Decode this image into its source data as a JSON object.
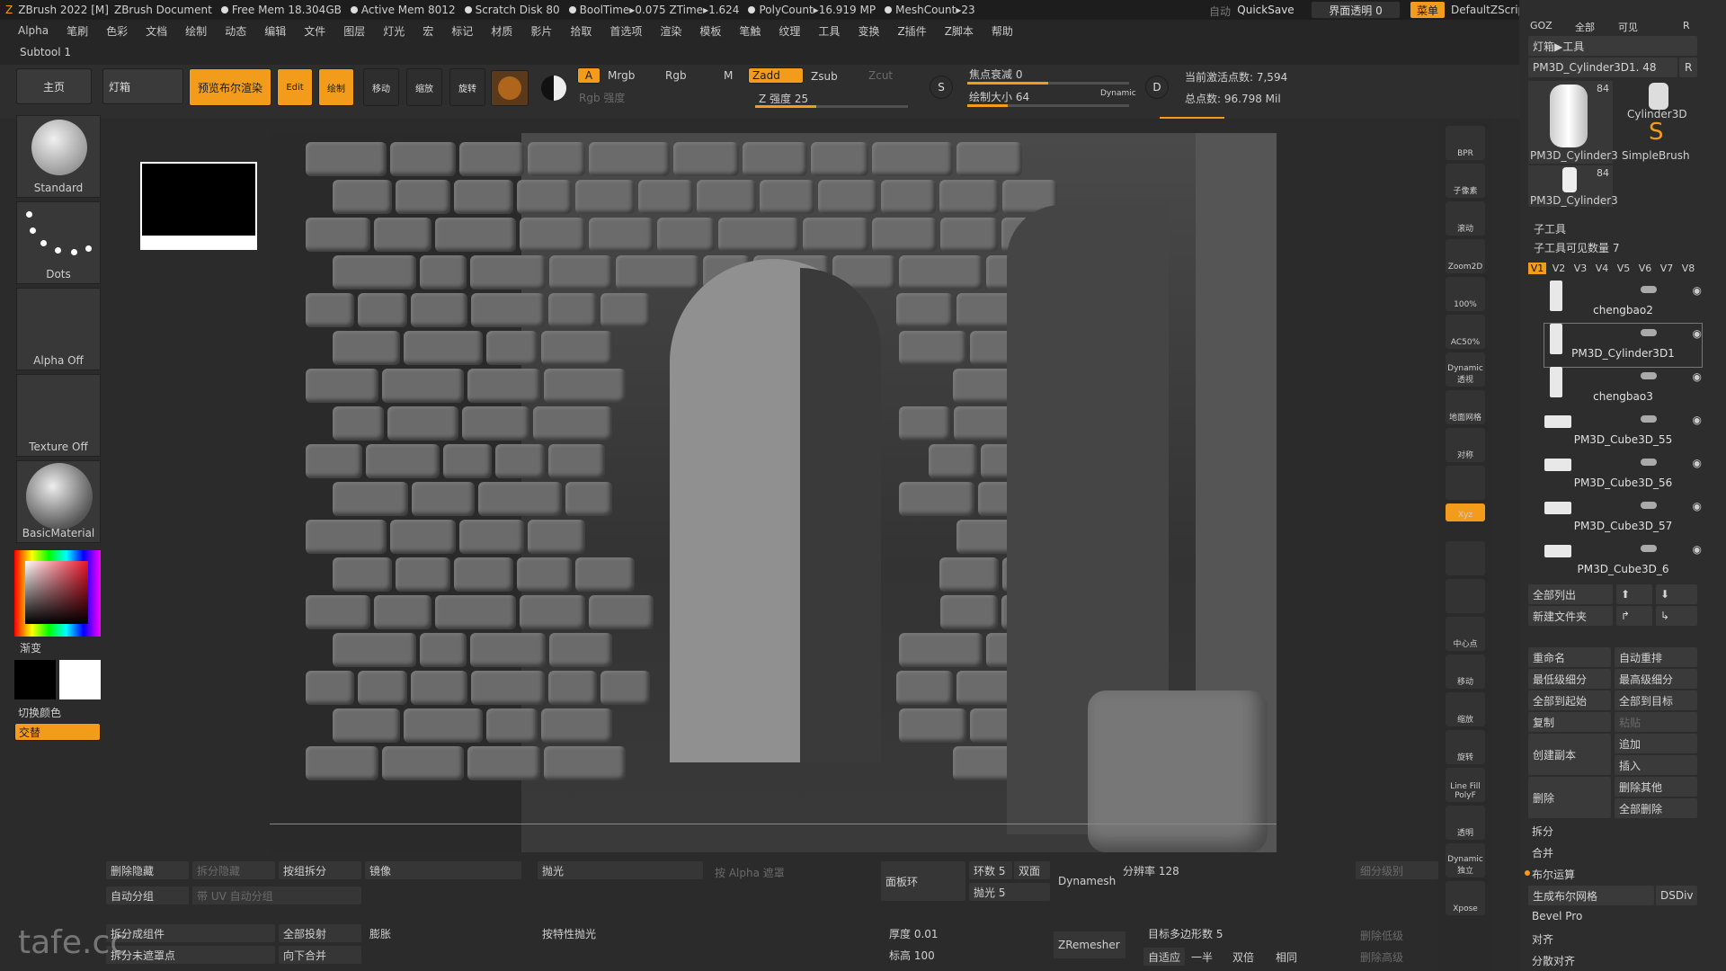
{
  "titlebar": {
    "app": "ZBrush 2022 [M]",
    "doc": "ZBrush Document",
    "free_mem": "Free Mem 18.304GB",
    "active_mem": "Active Mem 8012",
    "scratch": "Scratch Disk 80",
    "booltime": "BoolTime▸0.075 ZTime▸1.624",
    "polycount": "PolyCount▸16.919 MP",
    "meshcount": "MeshCount▸23",
    "auto": "自动",
    "quicksave": "QuickSave",
    "transparency": "界面透明 0",
    "menu": "菜单",
    "script": "DefaultZScript"
  },
  "menubar": [
    "Alpha",
    "笔刷",
    "色彩",
    "文档",
    "绘制",
    "动态",
    "编辑",
    "文件",
    "图层",
    "灯光",
    "宏",
    "标记",
    "材质",
    "影片",
    "拾取",
    "首选项",
    "渲染",
    "模板",
    "笔触",
    "纹理",
    "工具",
    "变换",
    "Z插件",
    "Z脚本",
    "帮助"
  ],
  "subtool_label": "Subtool 1",
  "toolrow": {
    "home": "主页",
    "lightbox": "灯箱",
    "bpr": "预览布尔渲染",
    "edit": "Edit",
    "draw": "绘制",
    "move": "移动",
    "scale": "缩放",
    "rotate": "旋转",
    "a": "A",
    "mrgb": "Mrgb",
    "rgb": "Rgb",
    "m": "M",
    "rgb_intensity": "Rgb 强度",
    "zadd": "Zadd",
    "zsub": "Zsub",
    "zcut": "Zcut",
    "z_intensity": "Z 强度 25",
    "focal": "焦点衰减 0",
    "draw_size": "绘制大小 64",
    "dynamic": "Dynamic",
    "active_points": "当前激活点数: 7,594",
    "total_points": "总点数: 96.798 Mil"
  },
  "leftpanel": {
    "brush": "Standard",
    "stroke": "Dots",
    "alpha": "Alpha Off",
    "texture": "Texture Off",
    "material": "BasicMaterial",
    "gradient": "渐变",
    "switch_color": "切换颜色",
    "alternate": "交替"
  },
  "shelf": [
    "BPR",
    "子像素",
    "滚动",
    "Zoom2D",
    "100%",
    "AC50%",
    "Dynamic 透视",
    "地面网格",
    "对称",
    "",
    "Xyz",
    "",
    "",
    "中心点",
    "移动",
    "缩放",
    "旋转",
    "Line Fill PolyF",
    "透明",
    "Dynamic 独立",
    "Xpose"
  ],
  "rightpanel": {
    "goz": "GOZ",
    "all": "全部",
    "visible": "可见",
    "r": "R",
    "lightbox_tool": "灯箱▶工具",
    "current_tool": "PM3D_Cylinder3D1. 48",
    "r2": "R",
    "thumbs": [
      {
        "name": "PM3D_Cylinder3",
        "count": "84"
      },
      {
        "name": "Cylinder3D",
        "count": ""
      },
      {
        "name": "SimpleBrush",
        "count": ""
      },
      {
        "name": "PM3D_Cylinder3",
        "count": "84"
      }
    ],
    "subtool_header": "子工具",
    "visible_count": "子工具可见数量 7",
    "versions": [
      "V1",
      "V2",
      "V3",
      "V4",
      "V5",
      "V6",
      "V7",
      "V8"
    ],
    "subtools": [
      "chengbao2",
      "PM3D_Cylinder3D1",
      "chengbao3",
      "PM3D_Cube3D_55",
      "PM3D_Cube3D_56",
      "PM3D_Cube3D_57",
      "PM3D_Cube3D_6"
    ],
    "list_all": "全部列出",
    "new_folder": "新建文件夹",
    "rename": "重命名",
    "auto_reorder": "自动重排",
    "lowest_sub": "最低级细分",
    "highest_sub": "最高级细分",
    "all_to_start": "全部到起始",
    "all_to_target": "全部到目标",
    "copy": "复制",
    "paste": "粘贴",
    "create_copy": "创建副本",
    "append": "追加",
    "insert": "插入",
    "delete": "删除",
    "delete_other": "删除其他",
    "delete_all": "全部删除",
    "split": "拆分",
    "merge": "合并",
    "boolean": "布尔运算",
    "gen_bool_mesh": "生成布尔网格",
    "dsdiv": "DSDiv",
    "bevel_pro": "Bevel Pro",
    "align": "对齐",
    "distribute": "分散对齐"
  },
  "bottombar": {
    "del_hidden": "删除隐藏",
    "split_hidden": "拆分隐藏",
    "split_by_group": "按组拆分",
    "mirror": "镜像",
    "polish": "抛光",
    "alpha_mask": "按 Alpha 遮罩",
    "panel_loops": "面板环",
    "loops": "环数 5",
    "double": "双面",
    "polish5": "抛光 5",
    "dynamesh": "Dynamesh",
    "resolution": "分辨率 128",
    "subdiv_level": "细分级别",
    "auto_group": "自动分组",
    "uv_group": "带 UV 自动分组",
    "split_parts": "拆分成组件",
    "project_all": "全部投射",
    "inflate": "膨胀",
    "feature_polish": "按特性抛光",
    "thickness": "厚度 0.01",
    "zremesher": "ZRemesher",
    "target_poly": "目标多边形数 5",
    "del_lower": "删除低级",
    "split_unmasked": "拆分未遮罩点",
    "merge_down": "向下合并",
    "height": "标高 100",
    "adaptive": "自适应",
    "half": "一半",
    "double2": "双倍",
    "same": "相同",
    "del_higher": "删除高级"
  },
  "watermark": "tafe.cc",
  "colors": {
    "accent": "#f39c1c",
    "bg": "#2b2b2b",
    "panel": "#3a3a3a"
  }
}
